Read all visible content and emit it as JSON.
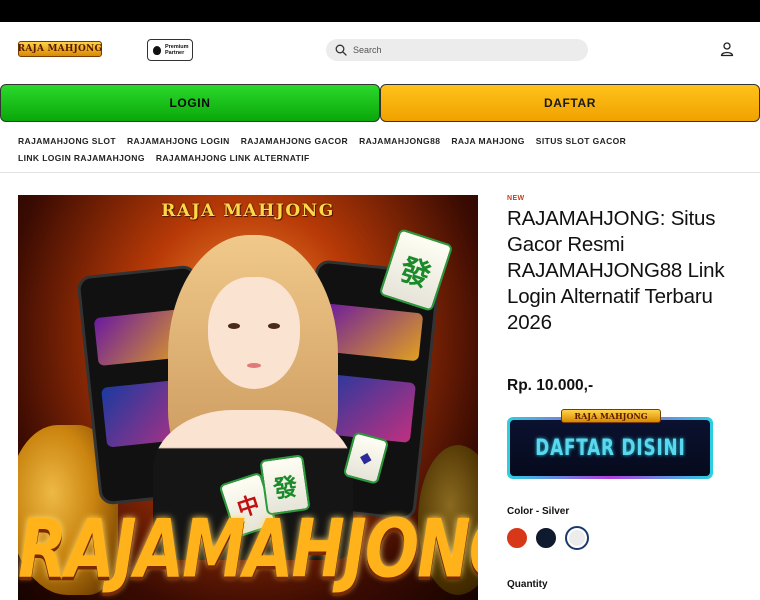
{
  "header": {
    "logo_text": "RAJA MAHJONG",
    "partner_badge_line1": "Premium",
    "partner_badge_line2": "Partner",
    "search_placeholder": "Search"
  },
  "buttons": {
    "login_label": "LOGIN",
    "daftar_label": "DAFTAR",
    "login_color": "#1fc41f",
    "daftar_color": "#f7b20d"
  },
  "nav": {
    "items": [
      "RAJAMAHJONG SLOT",
      "RAJAMAHJONG LOGIN",
      "RAJAMAHJONG GACOR",
      "RAJAMAHJONG88",
      "RAJA MAHJONG",
      "SITUS SLOT GACOR",
      "LINK LOGIN RAJAMAHJONG",
      "RAJAMAHJONG LINK ALTERNATIF"
    ]
  },
  "hero": {
    "brand_text": "RAJA MAHJONG",
    "big_text": "RAJAMAHJONG"
  },
  "product": {
    "badge": "NEW",
    "title": "RAJAMAHJONG: Situs Gacor Resmi RAJAMAHJONG88 Link Login Alternatif Terbaru 2026",
    "price": "Rp. 10.000,-",
    "cta_logo": "RAJA MAHJONG",
    "cta_label": "DAFTAR DISINI",
    "color_label": "Color - Silver",
    "colors": [
      "#d8381a",
      "#0f1a2e",
      "#ececec"
    ],
    "quantity_label": "Quantity"
  }
}
